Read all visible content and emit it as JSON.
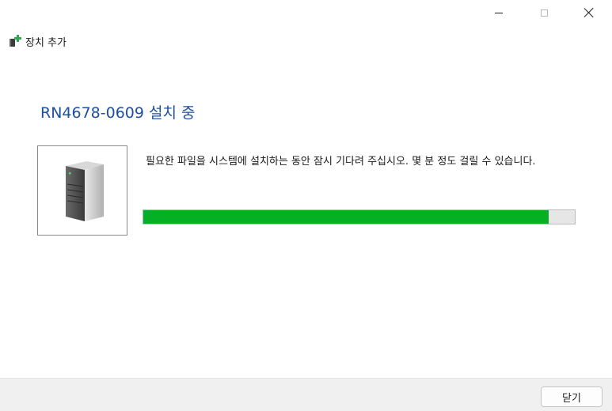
{
  "window": {
    "title": "장치 추가",
    "app_icon": "add-device-icon",
    "controls": [
      "minimize-icon",
      "maximize-icon",
      "close-icon"
    ]
  },
  "main": {
    "heading": "RN4678-0609 설치 중",
    "device_image": "server-tower-icon",
    "message": "필요한 파일을 시스템에 설치하는 동안 잠시 기다려 주십시오. 몇 분 정도 걸릴 수 있습니다.",
    "progress_fraction": 0.94
  },
  "footer": {
    "close_label": "닫기"
  },
  "colors": {
    "heading": "#1f4fa3",
    "progress_fill": "#06b025",
    "progress_track": "#e6e6e6",
    "footer_bg": "#f0f0f0"
  }
}
